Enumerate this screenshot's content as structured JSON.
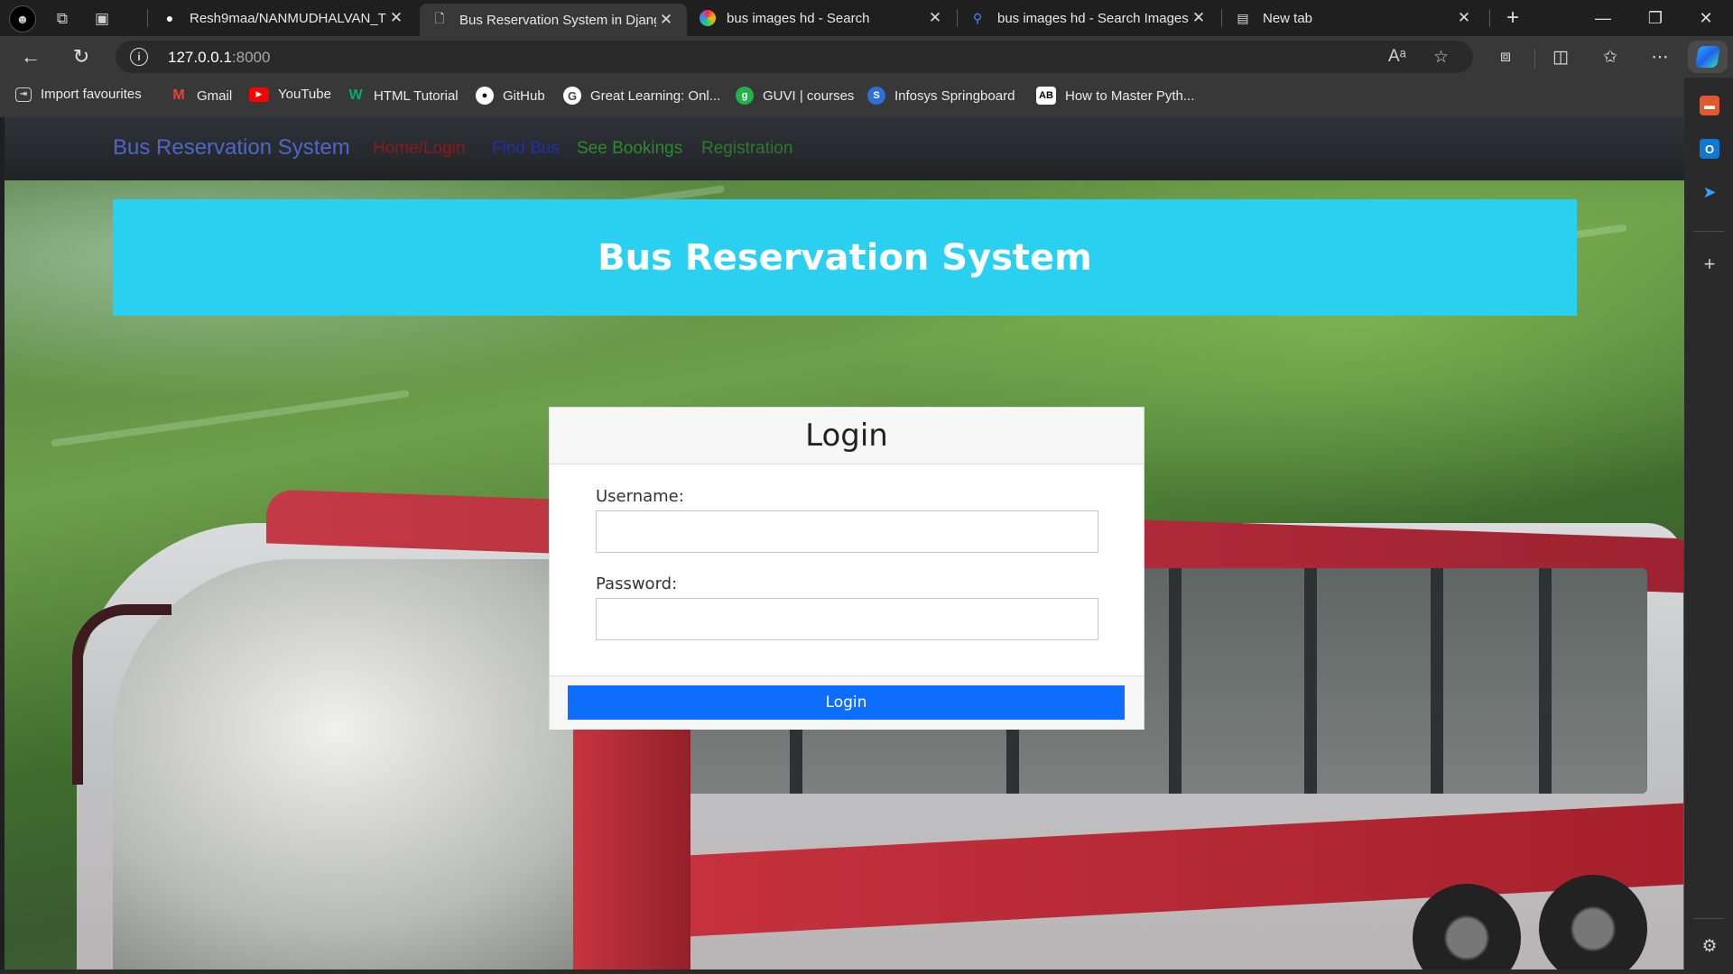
{
  "browser": {
    "tabs": [
      {
        "title": "Resh9maa/NANMUDHALVAN_TU",
        "favicon": "github-icon",
        "active": false
      },
      {
        "title": "Bus Reservation System in Djang",
        "favicon": "document-icon",
        "active": true
      },
      {
        "title": "bus images hd - Search",
        "favicon": "copilot-search-icon",
        "active": false
      },
      {
        "title": "bus images hd - Search Images",
        "favicon": "search-icon",
        "active": false
      },
      {
        "title": "New tab",
        "favicon": "new-tab-icon",
        "active": false
      }
    ],
    "address": {
      "host": "127.0.0.1",
      "port": ":8000"
    },
    "bookmarks": [
      {
        "label": "Import favourites",
        "icon": "import-icon"
      },
      {
        "label": "Gmail",
        "icon": "gmail-icon"
      },
      {
        "label": "YouTube",
        "icon": "youtube-icon"
      },
      {
        "label": "HTML Tutorial",
        "icon": "w3schools-icon"
      },
      {
        "label": "GitHub",
        "icon": "github-icon"
      },
      {
        "label": "Great Learning: Onl...",
        "icon": "google-icon"
      },
      {
        "label": "GUVI | courses",
        "icon": "guvi-icon"
      },
      {
        "label": "Infosys Springboard",
        "icon": "infosys-icon"
      },
      {
        "label": "How to Master Pyth...",
        "icon": "ab-icon"
      }
    ]
  },
  "site": {
    "brand": "Bus Reservation System",
    "nav": [
      {
        "label": "Home/Login",
        "color": "#8b1a1a"
      },
      {
        "label": "Find Bus",
        "color": "#1f2fb0"
      },
      {
        "label": "See Bookings",
        "color": "#2f8a2f"
      },
      {
        "label": "Registration",
        "color": "#2a7a2a"
      }
    ],
    "banner_title": "Bus Reservation System",
    "login": {
      "heading": "Login",
      "username_label": "Username:",
      "username_value": "",
      "password_label": "Password:",
      "password_value": "",
      "submit_label": "Login"
    }
  },
  "colors": {
    "banner": "#2bd0f0",
    "button": "#0d6efd",
    "brand": "#4f66c7"
  }
}
